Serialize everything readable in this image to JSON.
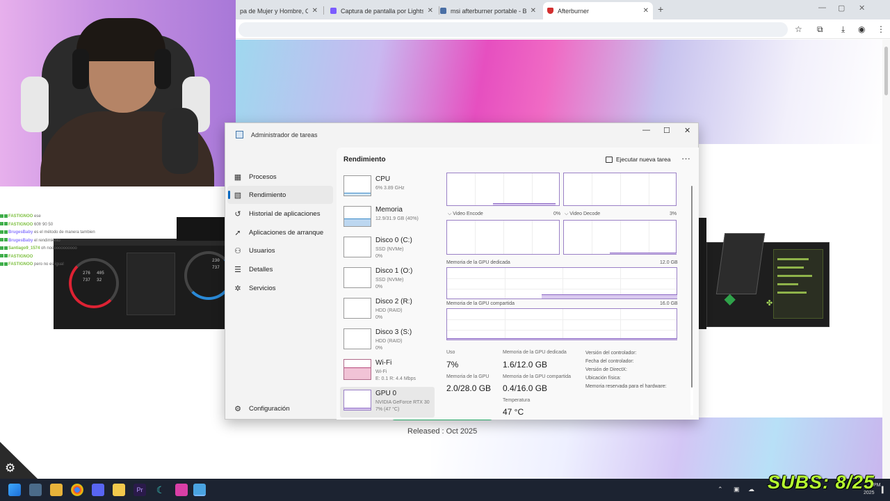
{
  "browser": {
    "tabs": [
      {
        "label": "pa de Mujer y Hombre, Com",
        "color": "#3b3b3b"
      },
      {
        "label": "Captura de pantalla por Lightsh",
        "color": "#7c5cff"
      },
      {
        "label": "msi afterburner portable - Búsq",
        "color": "#4a6fa5"
      },
      {
        "label": "Afterburner",
        "color": "#d32f2f"
      }
    ],
    "new_tab": "+",
    "window_controls": [
      "—",
      "▢",
      "✕"
    ]
  },
  "page": {
    "released": "Released : Oct 2025",
    "accent": "#2fcf7f"
  },
  "chat": [
    {
      "user": "FASTIGNOO",
      "msg": "ese",
      "color": "green"
    },
    {
      "user": "FASTIGNOO",
      "msg": "60fr 90 50",
      "color": "green"
    },
    {
      "user": "BrugesBaby",
      "msg": "es el método de manera tambien",
      "color": "purple"
    },
    {
      "user": "BrugesBaby",
      "msg": "el rendimiento",
      "color": "purple"
    },
    {
      "user": "Santiago9_1574",
      "msg": "oh noooooooooooo",
      "color": "green"
    },
    {
      "user": "FASTIGNOO",
      "msg": "",
      "color": "green"
    },
    {
      "user": "FASTIGNOO",
      "msg": "pero no es igual",
      "color": "green"
    }
  ],
  "left_card": {
    "gauge1": [
      "276",
      "405",
      "737",
      "32"
    ],
    "gauge2": [
      "230",
      "737"
    ]
  },
  "taskmanager": {
    "title": "Administrador de tareas",
    "controls": [
      "—",
      "☐",
      "✕"
    ],
    "nav": [
      {
        "label": "Procesos",
        "icon": "grid-icon"
      },
      {
        "label": "Rendimiento",
        "icon": "performance-icon",
        "selected": true
      },
      {
        "label": "Historial de aplicaciones",
        "icon": "history-icon"
      },
      {
        "label": "Aplicaciones de arranque",
        "icon": "startup-icon"
      },
      {
        "label": "Usuarios",
        "icon": "users-icon"
      },
      {
        "label": "Detalles",
        "icon": "details-icon"
      },
      {
        "label": "Servicios",
        "icon": "services-icon"
      }
    ],
    "settings": "Configuración",
    "header": {
      "title": "Rendimiento",
      "new_task": "Ejecutar nueva tarea",
      "more": "···"
    },
    "devices": [
      {
        "name": "CPU",
        "sub1": "6% 3.89 GHz",
        "sub2": "",
        "sub3": "",
        "fill": 0.06
      },
      {
        "name": "Memoria",
        "sub1": "12.9/31.9 GB (40%)",
        "sub2": "",
        "sub3": "",
        "fill": 0.4
      },
      {
        "name": "Disco 0 (C:)",
        "sub1": "SSD (NVMe)",
        "sub2": "0%",
        "sub3": "",
        "fill": 0
      },
      {
        "name": "Disco 1 (O:)",
        "sub1": "SSD (NVMe)",
        "sub2": "0%",
        "sub3": "",
        "fill": 0
      },
      {
        "name": "Disco 2 (R:)",
        "sub1": "HDD (RAID)",
        "sub2": "0%",
        "sub3": "",
        "fill": 0
      },
      {
        "name": "Disco 3 (S:)",
        "sub1": "HDD (RAID)",
        "sub2": "0%",
        "sub3": "",
        "fill": 0
      },
      {
        "name": "Wi-Fi",
        "sub1": "Wi-Fi",
        "sub2": "E: 0.1 R: 4.4 Mbps",
        "sub3": "",
        "fill": 0.5
      },
      {
        "name": "GPU 0",
        "sub1": "NVIDIA GeForce RTX 30",
        "sub2": "7% (47 °C)",
        "sub3": "",
        "fill": 0.07,
        "selected": true
      }
    ],
    "gpu": {
      "video_encode": "Video Encode",
      "video_encode_pct": "0%",
      "video_decode": "Video Decode",
      "video_decode_pct": "3%",
      "dedicated_label": "Memoria de la GPU dedicada",
      "dedicated_max": "12.0 GB",
      "shared_label": "Memoria de la GPU compartida",
      "shared_max": "16.0 GB",
      "stats": {
        "uso_label": "Uso",
        "uso": "7%",
        "ded_label": "Memoria de la GPU dedicada",
        "ded": "1.6/12.0 GB",
        "gpumem_label": "Memoria de la GPU",
        "gpumem": "2.0/28.0 GB",
        "shared_label": "Memoria de la GPU compartida",
        "shared": "0.4/16.0 GB",
        "temp_label": "Temperatura",
        "temp": "47 °C"
      },
      "details": [
        "Versión del controlador:",
        "Fecha del controlador:",
        "Versión de DirectX:",
        "Ubicación física:",
        "Memoria reservada para el hardware:"
      ]
    }
  },
  "overlay": {
    "subs": "SUBS: 8/25",
    "subs_color": "#b6ff30"
  },
  "taskbar": {
    "time": "PM",
    "date": "2025"
  }
}
